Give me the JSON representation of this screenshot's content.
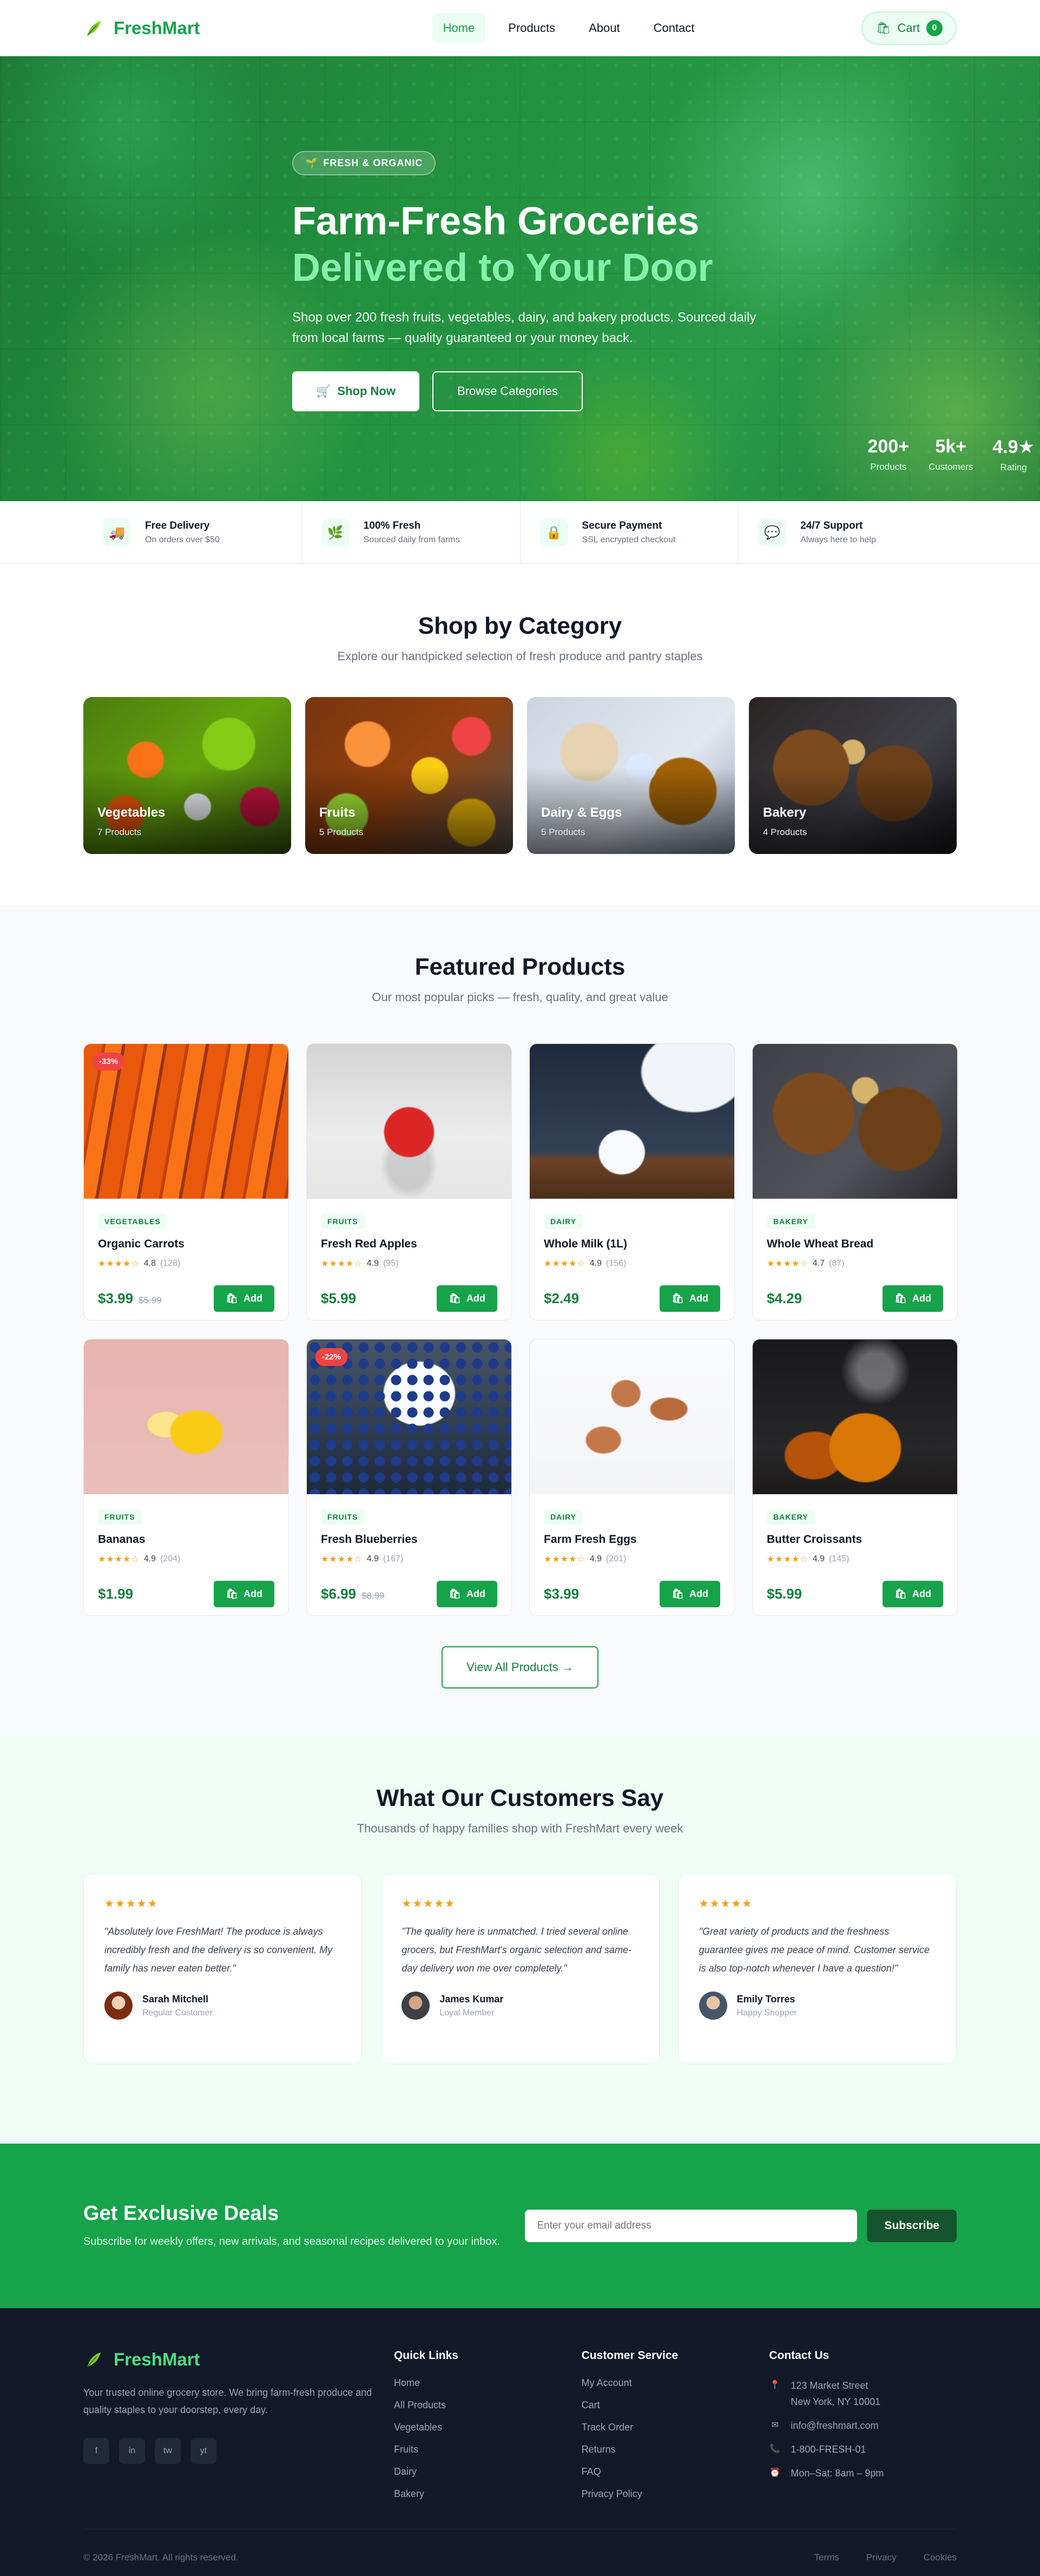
{
  "brand": {
    "name": "FreshMart"
  },
  "nav": {
    "links": [
      "Home",
      "Products",
      "About",
      "Contact"
    ],
    "cart_label": "Cart",
    "cart_count": "0"
  },
  "hero": {
    "badge": "FRESH & ORGANIC",
    "title_line1": "Farm-Fresh Groceries",
    "title_line2": "Delivered to Your Door",
    "subtitle": "Shop over 200 fresh fruits, vegetables, dairy, and bakery products. Sourced daily from local farms — quality guaranteed or your money back.",
    "primary_cta": "Shop Now",
    "secondary_cta": "Browse Categories",
    "stats": [
      {
        "value": "200+",
        "label": "Products"
      },
      {
        "value": "5k+",
        "label": "Customers"
      },
      {
        "value": "4.9★",
        "label": "Rating"
      }
    ]
  },
  "features": [
    {
      "icon": "truck-icon",
      "title": "Free Delivery",
      "sub": "On orders over $50"
    },
    {
      "icon": "leaf-icon",
      "title": "100% Fresh",
      "sub": "Sourced daily from farms"
    },
    {
      "icon": "lock-icon",
      "title": "Secure Payment",
      "sub": "SSL encrypted checkout"
    },
    {
      "icon": "chat-icon",
      "title": "24/7 Support",
      "sub": "Always here to help"
    }
  ],
  "categories": {
    "title": "Shop by Category",
    "subtitle": "Explore our handpicked selection of fresh produce and pantry staples",
    "items": [
      {
        "name": "Vegetables",
        "count": "7 Products"
      },
      {
        "name": "Fruits",
        "count": "5 Products"
      },
      {
        "name": "Dairy & Eggs",
        "count": "5 Products"
      },
      {
        "name": "Bakery",
        "count": "4 Products"
      }
    ]
  },
  "featured": {
    "title": "Featured Products",
    "subtitle": "Our most popular picks — fresh, quality, and great value",
    "add_label": "Add",
    "view_all": "View All Products →",
    "products": [
      {
        "category": "VEGETABLES",
        "name": "Organic Carrots",
        "stars": "★★★★☆",
        "rating": "4.8",
        "reviews": "(128)",
        "price": "$3.99",
        "old_price": "$5.99",
        "discount": "-33%"
      },
      {
        "category": "FRUITS",
        "name": "Fresh Red Apples",
        "stars": "★★★★☆",
        "rating": "4.9",
        "reviews": "(95)",
        "price": "$5.99",
        "old_price": "",
        "discount": ""
      },
      {
        "category": "DAIRY",
        "name": "Whole Milk (1L)",
        "stars": "★★★★☆",
        "rating": "4.9",
        "reviews": "(156)",
        "price": "$2.49",
        "old_price": "",
        "discount": ""
      },
      {
        "category": "BAKERY",
        "name": "Whole Wheat Bread",
        "stars": "★★★★☆",
        "rating": "4.7",
        "reviews": "(87)",
        "price": "$4.29",
        "old_price": "",
        "discount": ""
      },
      {
        "category": "FRUITS",
        "name": "Bananas",
        "stars": "★★★★☆",
        "rating": "4.9",
        "reviews": "(204)",
        "price": "$1.99",
        "old_price": "",
        "discount": ""
      },
      {
        "category": "FRUITS",
        "name": "Fresh Blueberries",
        "stars": "★★★★☆",
        "rating": "4.9",
        "reviews": "(167)",
        "price": "$6.99",
        "old_price": "$8.99",
        "discount": "-22%"
      },
      {
        "category": "DAIRY",
        "name": "Farm Fresh Eggs",
        "stars": "★★★★☆",
        "rating": "4.9",
        "reviews": "(201)",
        "price": "$3.99",
        "old_price": "",
        "discount": ""
      },
      {
        "category": "BAKERY",
        "name": "Butter Croissants",
        "stars": "★★★★☆",
        "rating": "4.9",
        "reviews": "(145)",
        "price": "$5.99",
        "old_price": "",
        "discount": ""
      }
    ]
  },
  "testimonials": {
    "title": "What Our Customers Say",
    "subtitle": "Thousands of happy families shop with FreshMart every week",
    "items": [
      {
        "stars": "★★★★★",
        "quote": "\"Absolutely love FreshMart! The produce is always incredibly fresh and the delivery is so convenient. My family has never eaten better.\"",
        "name": "Sarah Mitchell",
        "role": "Regular Customer"
      },
      {
        "stars": "★★★★★",
        "quote": "\"The quality here is unmatched. I tried several online grocers, but FreshMart's organic selection and same-day delivery won me over completely.\"",
        "name": "James Kumar",
        "role": "Loyal Member"
      },
      {
        "stars": "★★★★★",
        "quote": "\"Great variety of products and the freshness guarantee gives me peace of mind. Customer service is also top-notch whenever I have a question!\"",
        "name": "Emily Torres",
        "role": "Happy Shopper"
      }
    ]
  },
  "newsletter": {
    "title": "Get Exclusive Deals",
    "subtitle": "Subscribe for weekly offers, new arrivals, and seasonal recipes delivered to your inbox.",
    "placeholder": "Enter your email address",
    "button": "Subscribe"
  },
  "footer": {
    "description": "Your trusted online grocery store. We bring farm-fresh produce and quality staples to your doorstep, every day.",
    "socials": [
      "f",
      "in",
      "tw",
      "yt"
    ],
    "quick_links_title": "Quick Links",
    "quick_links": [
      "Home",
      "All Products",
      "Vegetables",
      "Fruits",
      "Dairy",
      "Bakery"
    ],
    "service_title": "Customer Service",
    "service_links": [
      "My Account",
      "Cart",
      "Track Order",
      "Returns",
      "FAQ",
      "Privacy Policy"
    ],
    "contact_title": "Contact Us",
    "address_line1": "123 Market Street",
    "address_line2": "New York, NY 10001",
    "email": "info@freshmart.com",
    "phone": "1-800-FRESH-01",
    "hours": "Mon–Sat: 8am – 9pm",
    "copyright": "© 2026 FreshMart. All rights reserved.",
    "legal": [
      "Terms",
      "Privacy",
      "Cookies"
    ]
  },
  "colors": {
    "primary": "#16a34a",
    "primary_dark": "#15803d",
    "accent_light": "#86efac",
    "discount": "#ef4444",
    "footer_bg": "#111827"
  }
}
